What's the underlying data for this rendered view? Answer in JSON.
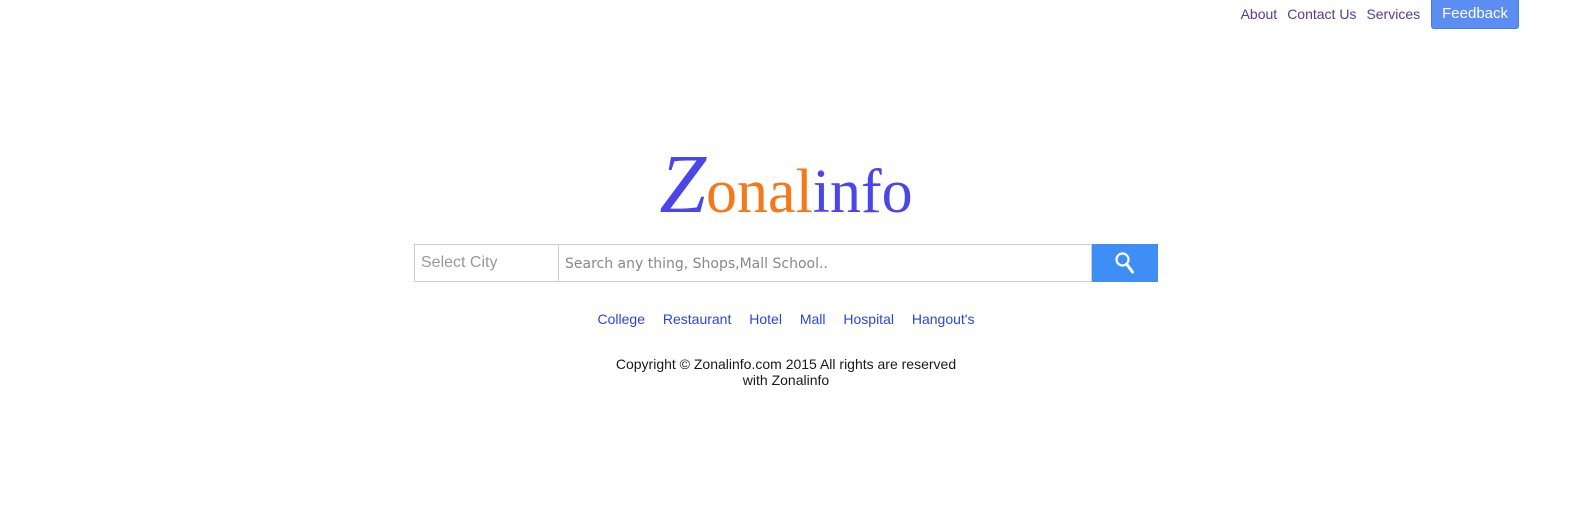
{
  "nav": {
    "about_label": "About",
    "contact_label": "Contact Us",
    "services_label": "Services",
    "feedback_label": "Feedback"
  },
  "logo": {
    "part1": "Z",
    "part2": "onal",
    "part3": "info"
  },
  "search": {
    "city_placeholder": "Select City",
    "query_placeholder": "Search any thing, Shops,Mall School..",
    "button_icon": "search-icon"
  },
  "categories": [
    "College",
    "Restaurant",
    "Hotel",
    "Mall",
    "Hospital",
    "Hangout's"
  ],
  "footer": {
    "line1": "Copyright © Zonalinfo.com 2015 All rights are reserved",
    "line2": "with Zonalinfo"
  },
  "colors": {
    "brand_blue": "#4a46e8",
    "brand_orange": "#f27a1a",
    "search_button": "#3f8ef5",
    "feedback_button": "#5b8df2",
    "category_link": "#2a45e0",
    "nav_link": "#5b3a8c"
  }
}
